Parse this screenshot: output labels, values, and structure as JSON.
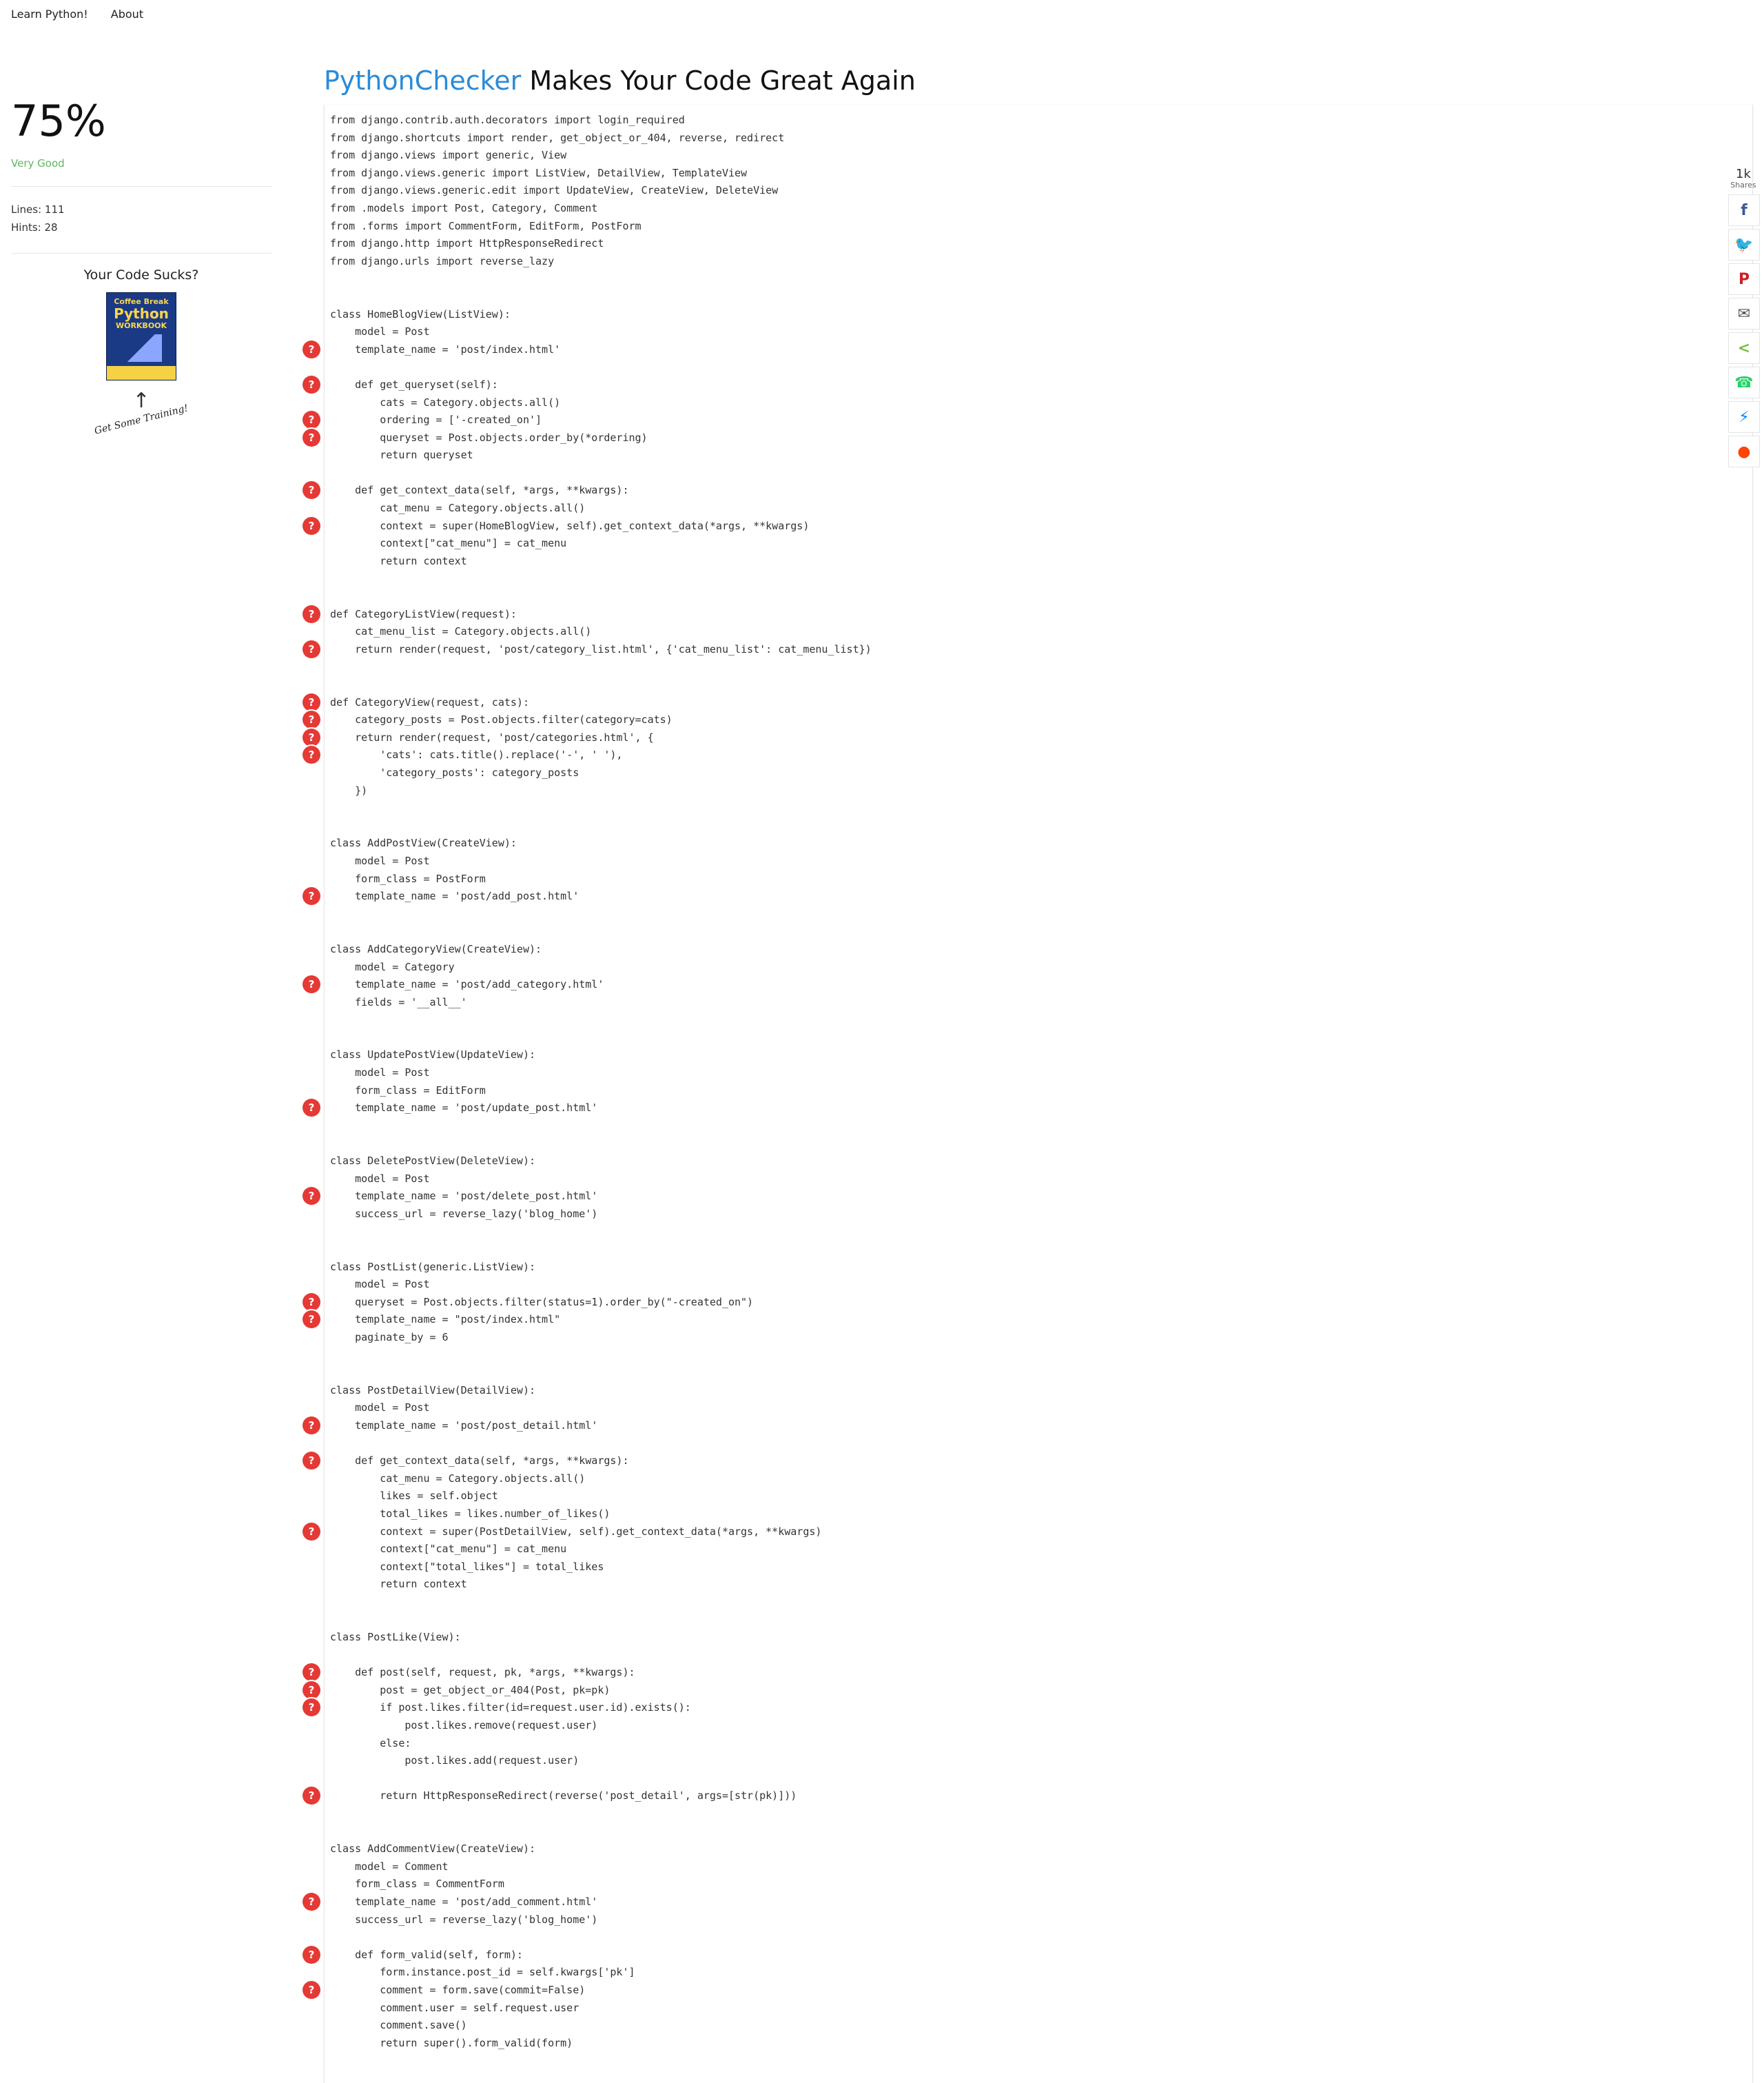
{
  "nav": {
    "items": [
      "Learn Python!",
      "About"
    ]
  },
  "sidebar": {
    "score": "75%",
    "rating": "Very Good",
    "lines": "Lines: 111",
    "hints": "Hints: 28",
    "cta_title": "Your Code Sucks?",
    "book": {
      "line1": "Coffee Break",
      "line2": "Python",
      "line3": "WORKBOOK"
    },
    "training": "Get Some Training!"
  },
  "heading": {
    "brand": "PythonChecker",
    "rest": " Makes Your Code Great Again"
  },
  "share": {
    "count": "1k",
    "label": "Shares",
    "buttons": [
      {
        "name": "facebook-icon",
        "glyph": "f",
        "color": "#3b5998"
      },
      {
        "name": "twitter-icon",
        "glyph": "🐦",
        "color": "#1da1f2"
      },
      {
        "name": "pinterest-icon",
        "glyph": "P",
        "color": "#cb2027"
      },
      {
        "name": "email-icon",
        "glyph": "✉",
        "color": "#555555"
      },
      {
        "name": "share-icon",
        "glyph": "<",
        "color": "#7ac143"
      },
      {
        "name": "whatsapp-icon",
        "glyph": "☎",
        "color": "#25d366"
      },
      {
        "name": "messenger-icon",
        "glyph": "⚡",
        "color": "#0084ff"
      },
      {
        "name": "reddit-icon",
        "glyph": "●",
        "color": "#ff4500"
      }
    ]
  },
  "code": {
    "hint_glyph": "?",
    "lines": [
      {
        "text": "from django.contrib.auth.decorators import login_required",
        "hint": false
      },
      {
        "text": "from django.shortcuts import render, get_object_or_404, reverse, redirect",
        "hint": false
      },
      {
        "text": "from django.views import generic, View",
        "hint": false
      },
      {
        "text": "from django.views.generic import ListView, DetailView, TemplateView",
        "hint": false
      },
      {
        "text": "from django.views.generic.edit import UpdateView, CreateView, DeleteView",
        "hint": false
      },
      {
        "text": "from .models import Post, Category, Comment",
        "hint": false
      },
      {
        "text": "from .forms import CommentForm, EditForm, PostForm",
        "hint": false
      },
      {
        "text": "from django.http import HttpResponseRedirect",
        "hint": false
      },
      {
        "text": "from django.urls import reverse_lazy",
        "hint": false
      },
      {
        "text": "",
        "hint": false
      },
      {
        "text": "",
        "hint": false
      },
      {
        "text": "class HomeBlogView(ListView):",
        "hint": false
      },
      {
        "text": "    model = Post",
        "hint": false
      },
      {
        "text": "    template_name = 'post/index.html'",
        "hint": true
      },
      {
        "text": "",
        "hint": false
      },
      {
        "text": "    def get_queryset(self):",
        "hint": true
      },
      {
        "text": "        cats = Category.objects.all()",
        "hint": false
      },
      {
        "text": "        ordering = ['-created_on']",
        "hint": true
      },
      {
        "text": "        queryset = Post.objects.order_by(*ordering)",
        "hint": true
      },
      {
        "text": "        return queryset",
        "hint": false
      },
      {
        "text": "",
        "hint": false
      },
      {
        "text": "    def get_context_data(self, *args, **kwargs):",
        "hint": true
      },
      {
        "text": "        cat_menu = Category.objects.all()",
        "hint": false
      },
      {
        "text": "        context = super(HomeBlogView, self).get_context_data(*args, **kwargs)",
        "hint": true
      },
      {
        "text": "        context[\"cat_menu\"] = cat_menu",
        "hint": false
      },
      {
        "text": "        return context",
        "hint": false
      },
      {
        "text": "",
        "hint": false
      },
      {
        "text": "",
        "hint": false
      },
      {
        "text": "def CategoryListView(request):",
        "hint": true
      },
      {
        "text": "    cat_menu_list = Category.objects.all()",
        "hint": false
      },
      {
        "text": "    return render(request, 'post/category_list.html', {'cat_menu_list': cat_menu_list})",
        "hint": true
      },
      {
        "text": "",
        "hint": false
      },
      {
        "text": "",
        "hint": false
      },
      {
        "text": "def CategoryView(request, cats):",
        "hint": true
      },
      {
        "text": "    category_posts = Post.objects.filter(category=cats)",
        "hint": true
      },
      {
        "text": "    return render(request, 'post/categories.html', {",
        "hint": true
      },
      {
        "text": "        'cats': cats.title().replace('-', ' '),",
        "hint": true
      },
      {
        "text": "        'category_posts': category_posts",
        "hint": false
      },
      {
        "text": "    })",
        "hint": false
      },
      {
        "text": "",
        "hint": false
      },
      {
        "text": "",
        "hint": false
      },
      {
        "text": "class AddPostView(CreateView):",
        "hint": false
      },
      {
        "text": "    model = Post",
        "hint": false
      },
      {
        "text": "    form_class = PostForm",
        "hint": false
      },
      {
        "text": "    template_name = 'post/add_post.html'",
        "hint": true
      },
      {
        "text": "",
        "hint": false
      },
      {
        "text": "",
        "hint": false
      },
      {
        "text": "class AddCategoryView(CreateView):",
        "hint": false
      },
      {
        "text": "    model = Category",
        "hint": false
      },
      {
        "text": "    template_name = 'post/add_category.html'",
        "hint": true
      },
      {
        "text": "    fields = '__all__'",
        "hint": false
      },
      {
        "text": "",
        "hint": false
      },
      {
        "text": "",
        "hint": false
      },
      {
        "text": "class UpdatePostView(UpdateView):",
        "hint": false
      },
      {
        "text": "    model = Post",
        "hint": false
      },
      {
        "text": "    form_class = EditForm",
        "hint": false
      },
      {
        "text": "    template_name = 'post/update_post.html'",
        "hint": true
      },
      {
        "text": "",
        "hint": false
      },
      {
        "text": "",
        "hint": false
      },
      {
        "text": "class DeletePostView(DeleteView):",
        "hint": false
      },
      {
        "text": "    model = Post",
        "hint": false
      },
      {
        "text": "    template_name = 'post/delete_post.html'",
        "hint": true
      },
      {
        "text": "    success_url = reverse_lazy('blog_home')",
        "hint": false
      },
      {
        "text": "",
        "hint": false
      },
      {
        "text": "",
        "hint": false
      },
      {
        "text": "class PostList(generic.ListView):",
        "hint": false
      },
      {
        "text": "    model = Post",
        "hint": false
      },
      {
        "text": "    queryset = Post.objects.filter(status=1).order_by(\"-created_on\")",
        "hint": true
      },
      {
        "text": "    template_name = \"post/index.html\"",
        "hint": true
      },
      {
        "text": "    paginate_by = 6",
        "hint": false
      },
      {
        "text": "",
        "hint": false
      },
      {
        "text": "",
        "hint": false
      },
      {
        "text": "class PostDetailView(DetailView):",
        "hint": false
      },
      {
        "text": "    model = Post",
        "hint": false
      },
      {
        "text": "    template_name = 'post/post_detail.html'",
        "hint": true
      },
      {
        "text": "",
        "hint": false
      },
      {
        "text": "    def get_context_data(self, *args, **kwargs):",
        "hint": true
      },
      {
        "text": "        cat_menu = Category.objects.all()",
        "hint": false
      },
      {
        "text": "        likes = self.object",
        "hint": false
      },
      {
        "text": "        total_likes = likes.number_of_likes()",
        "hint": false
      },
      {
        "text": "        context = super(PostDetailView, self).get_context_data(*args, **kwargs)",
        "hint": true
      },
      {
        "text": "        context[\"cat_menu\"] = cat_menu",
        "hint": false
      },
      {
        "text": "        context[\"total_likes\"] = total_likes",
        "hint": false
      },
      {
        "text": "        return context",
        "hint": false
      },
      {
        "text": "",
        "hint": false
      },
      {
        "text": "",
        "hint": false
      },
      {
        "text": "class PostLike(View):",
        "hint": false
      },
      {
        "text": "",
        "hint": false
      },
      {
        "text": "    def post(self, request, pk, *args, **kwargs):",
        "hint": true
      },
      {
        "text": "        post = get_object_or_404(Post, pk=pk)",
        "hint": true
      },
      {
        "text": "        if post.likes.filter(id=request.user.id).exists():",
        "hint": true
      },
      {
        "text": "            post.likes.remove(request.user)",
        "hint": false
      },
      {
        "text": "        else:",
        "hint": false
      },
      {
        "text": "            post.likes.add(request.user)",
        "hint": false
      },
      {
        "text": "",
        "hint": false
      },
      {
        "text": "        return HttpResponseRedirect(reverse('post_detail', args=[str(pk)]))",
        "hint": true
      },
      {
        "text": "",
        "hint": false
      },
      {
        "text": "",
        "hint": false
      },
      {
        "text": "class AddCommentView(CreateView):",
        "hint": false
      },
      {
        "text": "    model = Comment",
        "hint": false
      },
      {
        "text": "    form_class = CommentForm",
        "hint": false
      },
      {
        "text": "    template_name = 'post/add_comment.html'",
        "hint": true
      },
      {
        "text": "    success_url = reverse_lazy('blog_home')",
        "hint": false
      },
      {
        "text": "",
        "hint": false
      },
      {
        "text": "    def form_valid(self, form):",
        "hint": true
      },
      {
        "text": "        form.instance.post_id = self.kwargs['pk']",
        "hint": false
      },
      {
        "text": "        comment = form.save(commit=False)",
        "hint": true
      },
      {
        "text": "        comment.user = self.request.user",
        "hint": false
      },
      {
        "text": "        comment.save()",
        "hint": false
      },
      {
        "text": "        return super().form_valid(form)",
        "hint": false
      }
    ]
  }
}
